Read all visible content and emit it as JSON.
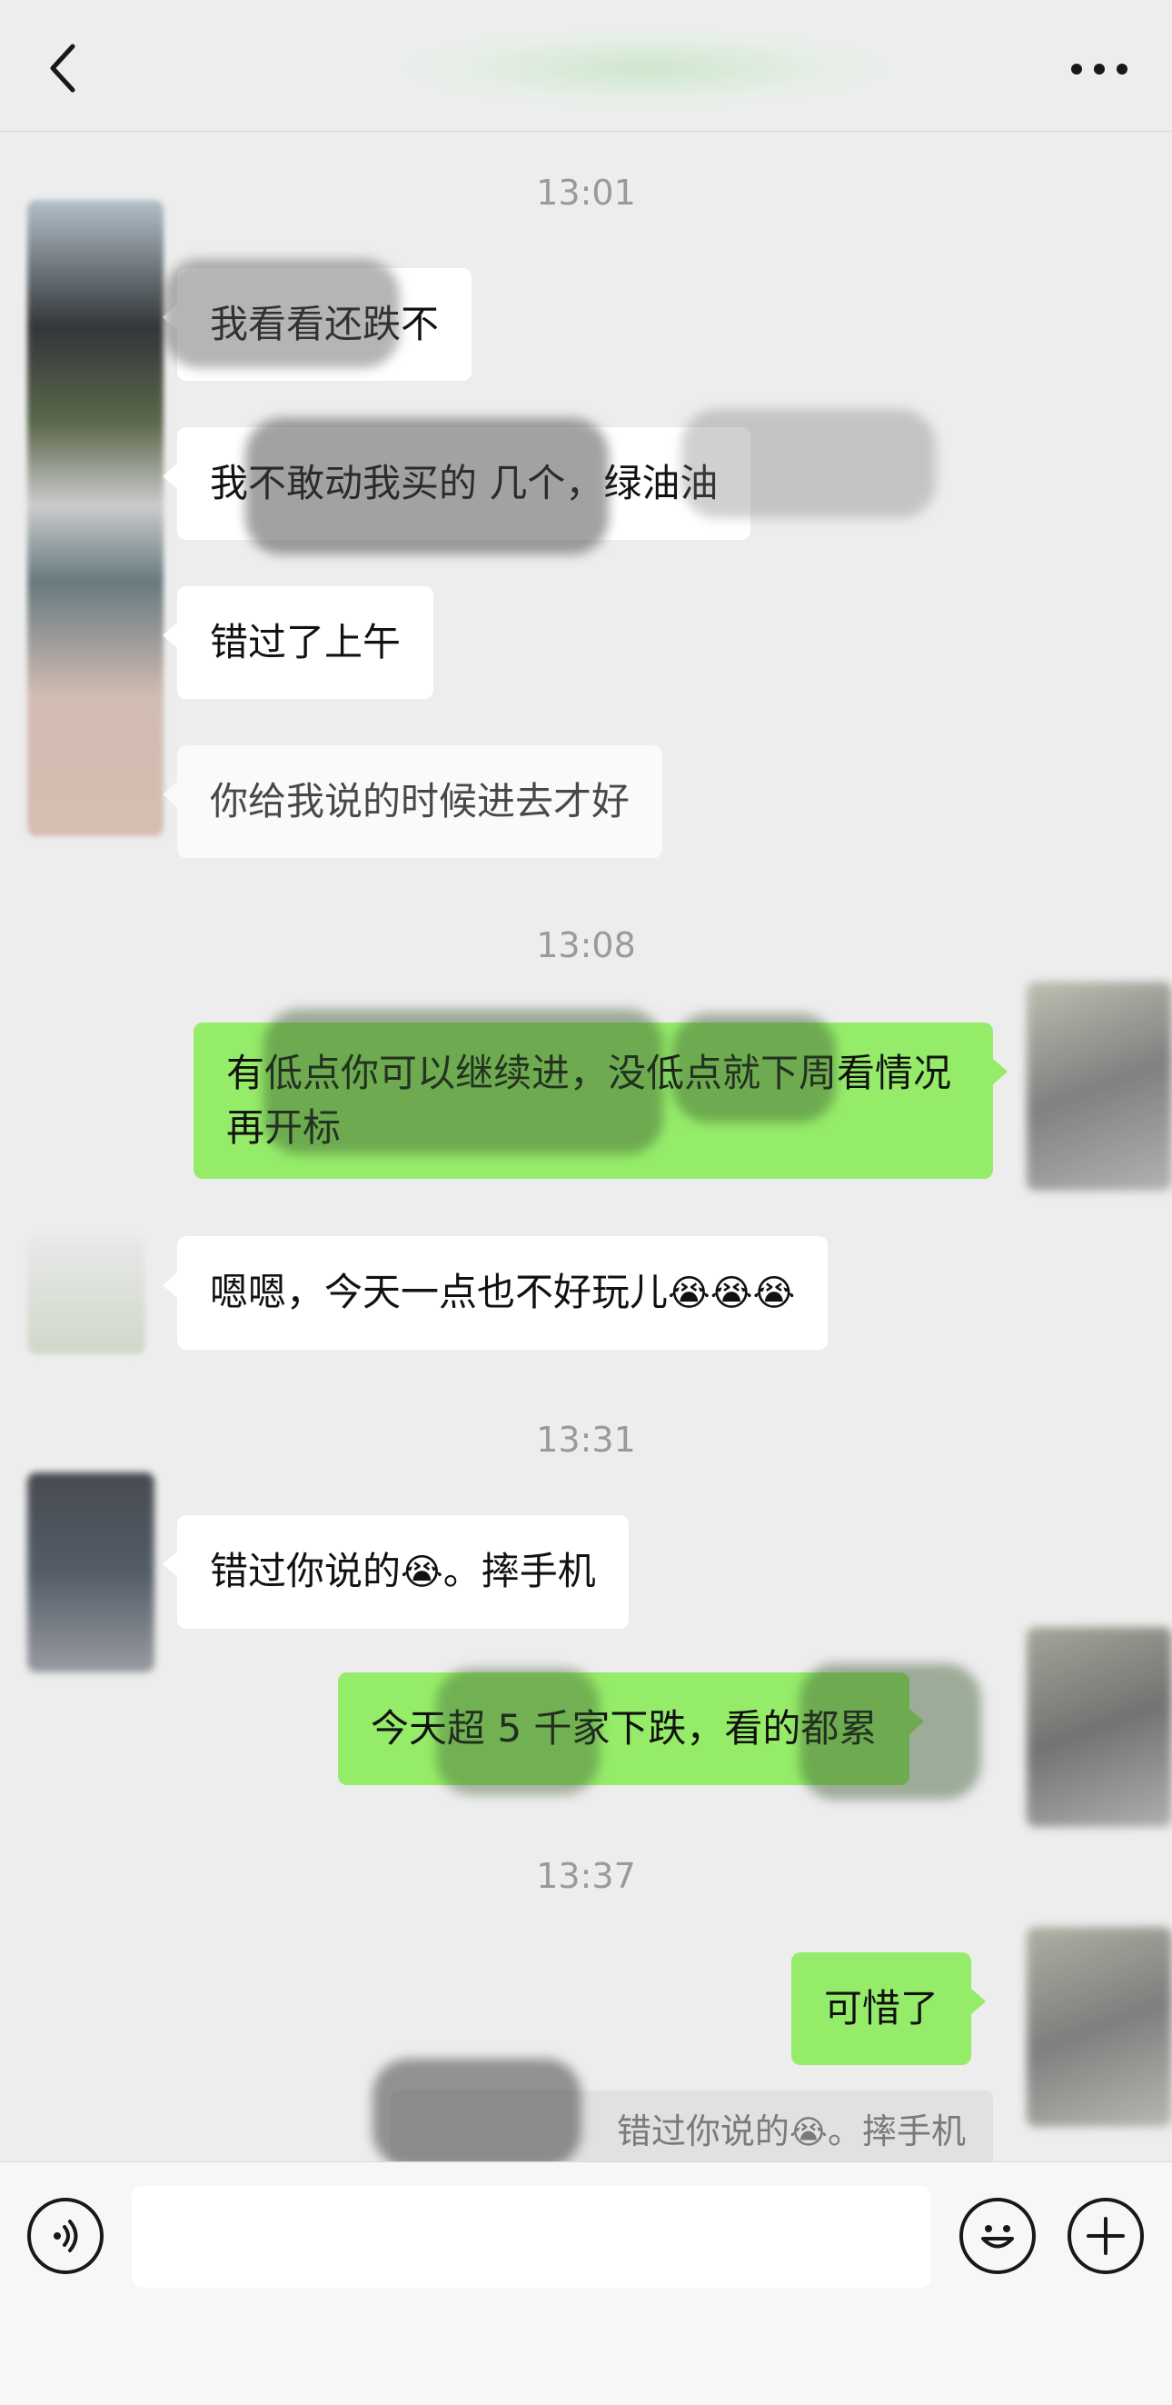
{
  "header": {
    "back_icon": "chevron-left-icon",
    "more_icon": "more-horizontal-icon",
    "title": ""
  },
  "messages": {
    "t1": "13:01",
    "m1": "我看看还跌不",
    "m2": "我不敢动我买的    几个，绿油油",
    "m3": "错过了上午",
    "m4": "你给我说的时候进去才好",
    "t2": "13:08",
    "m5": "有低点你可以继续进，没低点就下周看情况再开标",
    "m6_text": "嗯嗯，今天一点也不好玩儿",
    "m6_emoji": "😭😭😭",
    "t3": "13:31",
    "m7_a": "错过你说的",
    "m7_emoji": "😭",
    "m7_b": "。摔手机",
    "m8": "今天超 5 千家下跌，看的都累",
    "t4": "13:37",
    "m9": "可惜了",
    "quote_a": "错过你说的",
    "quote_emoji": "😭",
    "quote_b": "。摔手机"
  },
  "input": {
    "placeholder": "",
    "voice_icon": "voice-icon",
    "emoji_icon": "emoji-icon",
    "plus_icon": "plus-icon"
  },
  "colors": {
    "background": "#ededed",
    "incoming_bubble": "#ffffff",
    "outgoing_bubble": "#95ec69",
    "timestamp": "#9a9a9a"
  }
}
